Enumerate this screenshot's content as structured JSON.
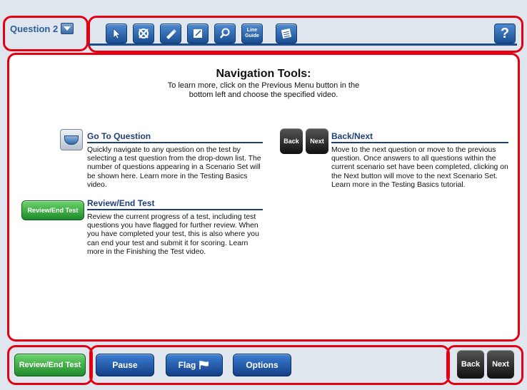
{
  "question_select": {
    "label": "Question 2"
  },
  "toolbar": {
    "line_guide_label": "Line Guide",
    "help_label": "?"
  },
  "content": {
    "title": "Navigation Tools:",
    "subtitle_line1": "To learn more, click on the Previous Menu button in the",
    "subtitle_line2": "bottom left and choose the specified video."
  },
  "sections": {
    "go_to_question": {
      "heading": "Go To Question",
      "body": "Quickly navigate to any question on the test by selecting a test question from the drop-down list. The number of questions appearing in a Scenario Set will be shown here. Learn more in the Testing Basics video."
    },
    "back_next": {
      "heading": "Back/Next",
      "body": "Move to the next question or move to the previous question. Once answers to all questions within the current scenario set have been completed, clicking on the Next button will move to the next Scenario Set. Learn more in the Testing Basics tutorial.",
      "back_label": "Back",
      "next_label": "Next"
    },
    "review_end": {
      "heading": "Review/End Test",
      "body": "Review the current progress of a test, including test questions you have flagged for further review. When you have completed your test, this is also where you can end your test and submit it for scoring. Learn more in the Finishing the Test video.",
      "button_label": "Review/End Test"
    }
  },
  "bottom": {
    "review_end_label": "Review/End Test",
    "pause_label": "Pause",
    "flag_label": "Flag",
    "options_label": "Options",
    "back_label": "Back",
    "next_label": "Next"
  }
}
